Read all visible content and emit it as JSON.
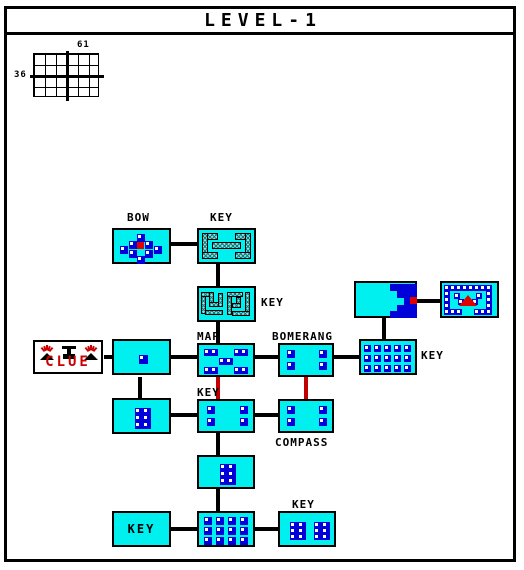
{
  "window": {
    "title": "LEVEL-1"
  },
  "legend": {
    "name": "dungeon-grid-legend",
    "top_value": "61",
    "left_value": "36",
    "columns": 12,
    "rows": 6
  },
  "colors": {
    "room_fill": "#00f0f0",
    "room_border": "#000000",
    "block": "#0000d8",
    "block_highlight": "#ffffff",
    "locked_door": "#c00000",
    "boss_marker": "#e00000",
    "clue_text": "#cc0000",
    "maze_wall": "#7fe8e8",
    "background": "#ffffff"
  },
  "clue": {
    "label": "CLUE",
    "icons": [
      "burst-icon",
      "statue-icon",
      "burst-icon"
    ]
  },
  "rooms": [
    {
      "id": "bow",
      "label": "BOW",
      "label_pos": "top",
      "contents": "diamond-blocks-with-red-center"
    },
    {
      "id": "key-maze-1",
      "label": "KEY",
      "label_pos": "top",
      "contents": "maze-bracket-pattern"
    },
    {
      "id": "key-maze-2",
      "label": "KEY",
      "label_pos": "right",
      "contents": "maze-spiral-pattern"
    },
    {
      "id": "clue-room",
      "label": "",
      "label_pos": "none",
      "contents": "single-block"
    },
    {
      "id": "map",
      "label": "MAP",
      "label_pos": "top",
      "contents": "five-block-pairs"
    },
    {
      "id": "bomerang",
      "label": "BOMERANG",
      "label_pos": "top",
      "contents": "four-blocks"
    },
    {
      "id": "key-grid",
      "label": "KEY",
      "label_pos": "right",
      "contents": "block-grid-5x3"
    },
    {
      "id": "boss-approach",
      "label": "",
      "label_pos": "none",
      "contents": "block-wall-with-red-door"
    },
    {
      "id": "boss",
      "label": "",
      "label_pos": "none",
      "contents": "boss-chamber"
    },
    {
      "id": "mid-left",
      "label": "",
      "label_pos": "none",
      "contents": "block-cluster-2x3"
    },
    {
      "id": "key-center",
      "label": "KEY",
      "label_pos": "top",
      "contents": "four-blocks"
    },
    {
      "id": "compass",
      "label": "COMPASS",
      "label_pos": "bottom",
      "contents": "four-blocks"
    },
    {
      "id": "lower-center",
      "label": "",
      "label_pos": "none",
      "contents": "block-cluster-2x3"
    },
    {
      "id": "key-left",
      "label": "KEY",
      "label_pos": "inside",
      "contents": "text-only"
    },
    {
      "id": "entry",
      "label": "",
      "label_pos": "none",
      "contents": "block-grid-4x3"
    },
    {
      "id": "key-right",
      "label": "KEY",
      "label_pos": "top",
      "contents": "two-block-clusters"
    }
  ],
  "corridors": {
    "normal_count": 15,
    "locked_count": 2,
    "locked_note": "red vertical doors below MAP and below BOMERANG"
  }
}
